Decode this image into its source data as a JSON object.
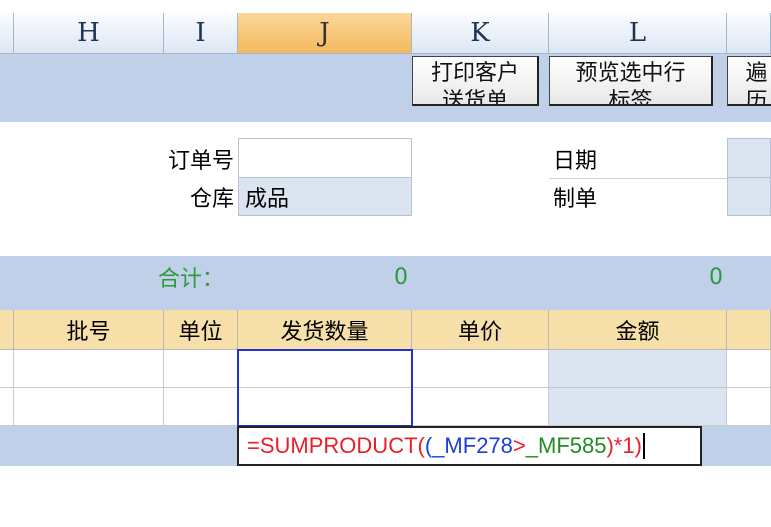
{
  "columns": [
    "H",
    "I",
    "J",
    "K",
    "L"
  ],
  "buttons": {
    "print": {
      "line1": "打印客户",
      "line2": "送货单"
    },
    "preview": {
      "line1": "预览选中行",
      "line2": "标签"
    },
    "more": {
      "line1": "遍",
      "line2": "历"
    }
  },
  "form": {
    "order_no_label": "订单号",
    "order_no_value": "",
    "warehouse_label": "仓库",
    "warehouse_value": "成品",
    "date_label": "日期",
    "maker_label": "制单"
  },
  "totals": {
    "label": "合计：",
    "value1": "0",
    "value2": "0"
  },
  "table": {
    "headers": [
      "批号",
      "单位",
      "发货数量",
      "单价",
      "金额"
    ]
  },
  "formula": {
    "eq": "=",
    "fn": "SUMPRODUCT(",
    "open": "(",
    "ref1": "_MF278",
    "op": ">",
    "ref2": "_MF585",
    "close": ")*1)"
  },
  "colors": {
    "selected_header": "#f5b95d",
    "band": "#bfd0e8",
    "green": "#2c9a3c",
    "formula_red": "#e8202a",
    "formula_blue": "#1b3fd8",
    "formula_green": "#228b22"
  }
}
